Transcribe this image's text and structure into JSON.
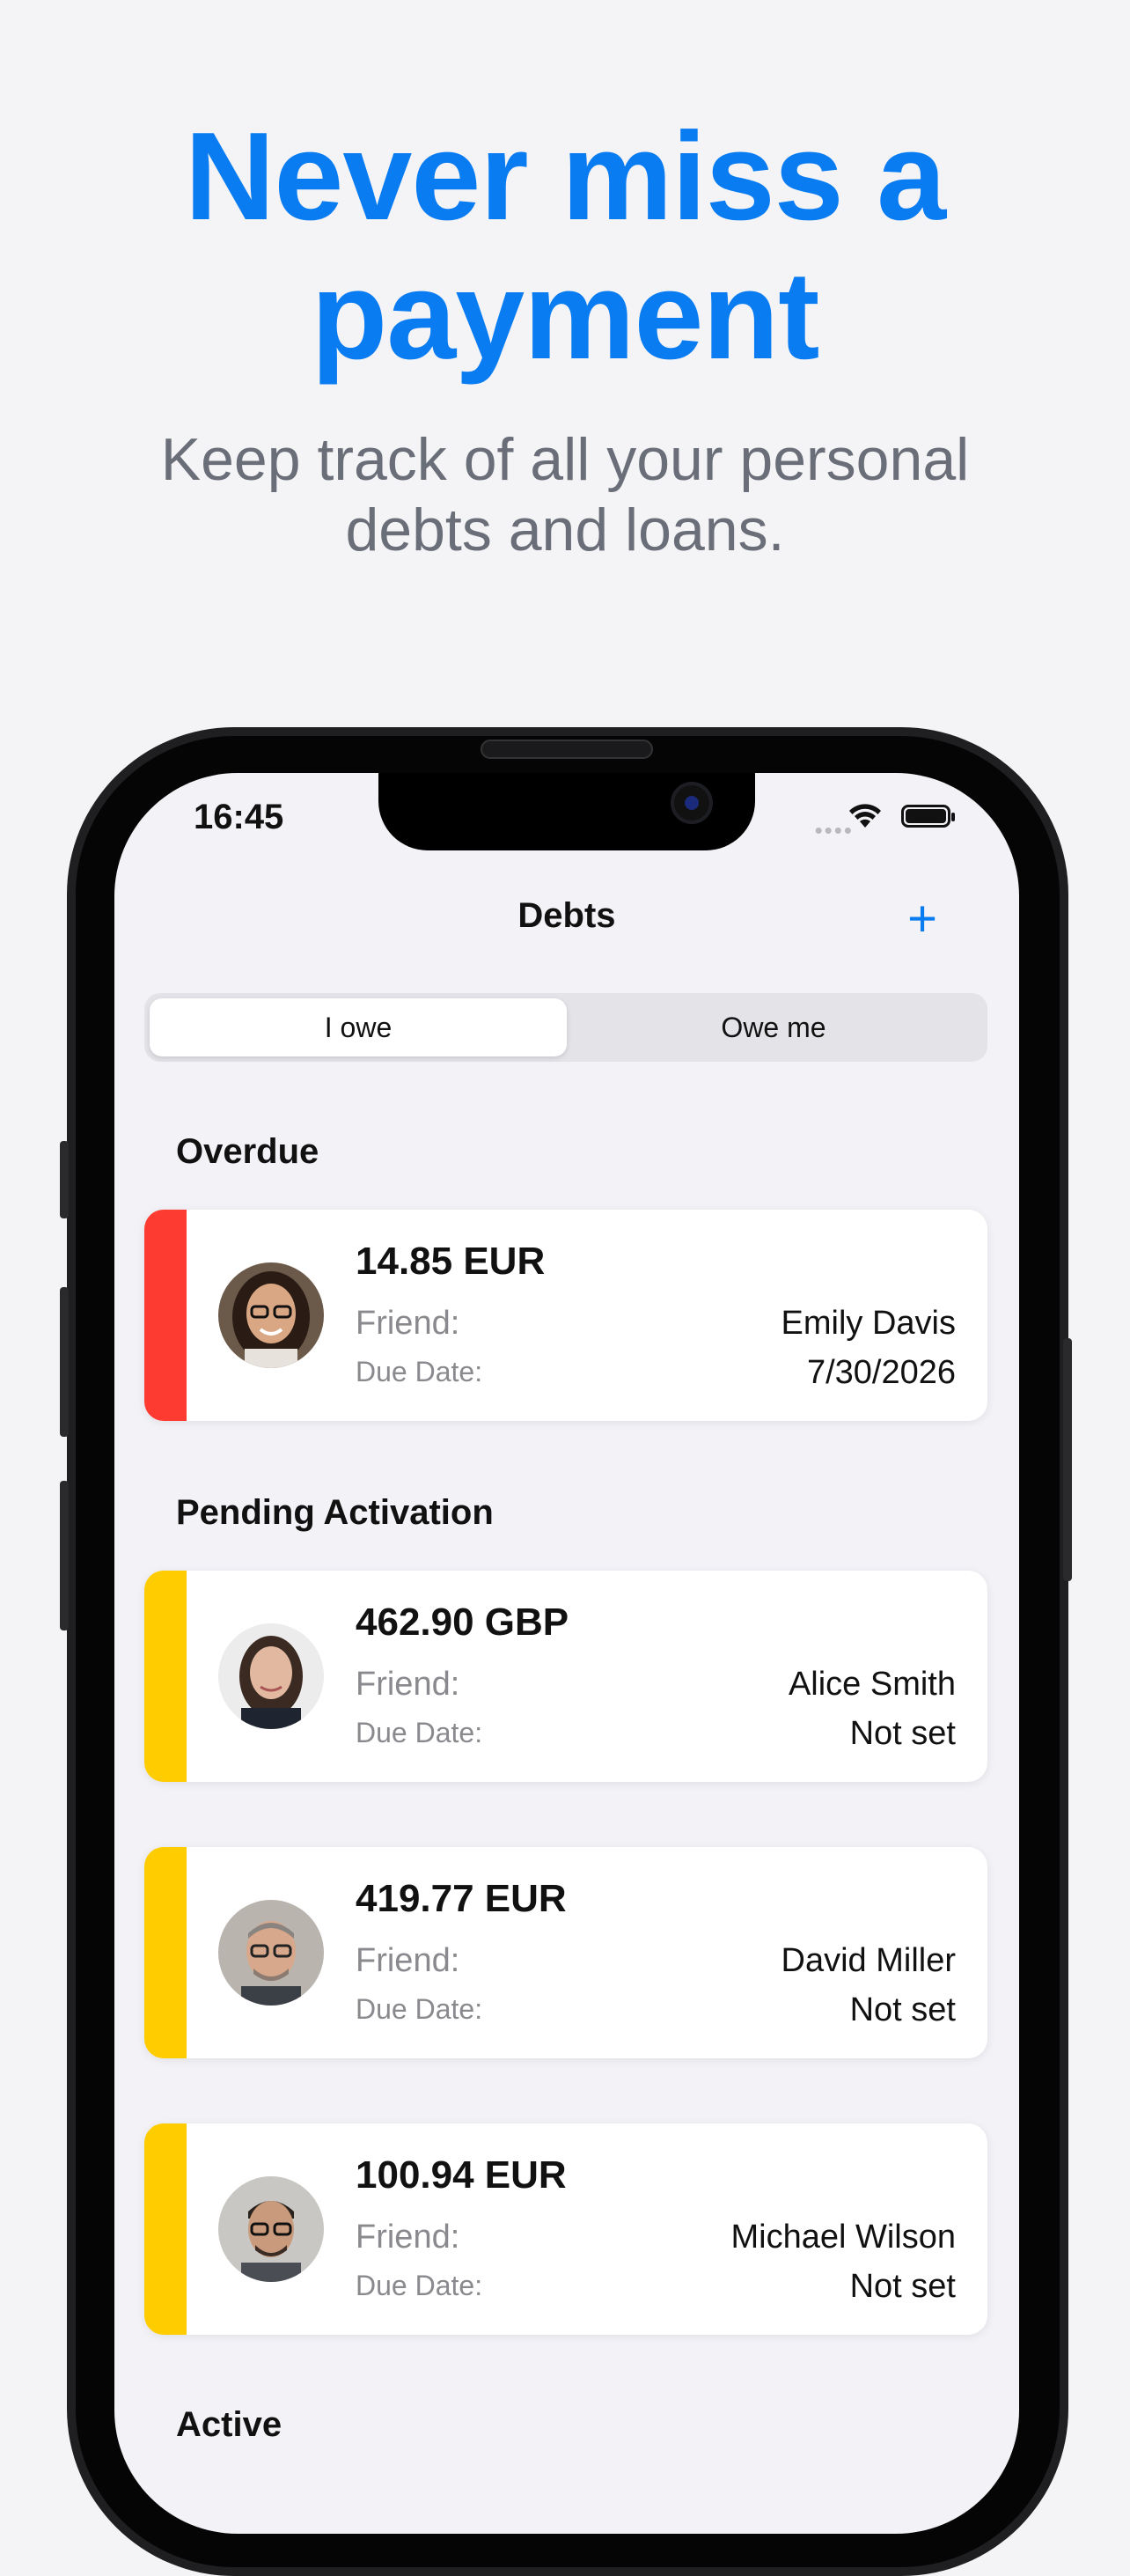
{
  "headline": {
    "line1": "Never miss a",
    "line2": "payment"
  },
  "subtitle": {
    "line1": "Keep track of all your personal",
    "line2": "debts and loans."
  },
  "status_bar": {
    "time": "16:45",
    "icons": [
      "wifi-icon",
      "battery-icon"
    ]
  },
  "nav": {
    "title": "Debts",
    "add_label": "+"
  },
  "segments": {
    "selected": "I owe",
    "items": [
      "I owe",
      "Owe me"
    ]
  },
  "sections": {
    "overdue": "Overdue",
    "pending": "Pending Activation",
    "active": "Active"
  },
  "labels": {
    "friend": "Friend:",
    "due_date": "Due Date:"
  },
  "colors": {
    "accent": "#0a7cf2",
    "overdue": "#fe3b30",
    "pending": "#ffcc00"
  },
  "debts": [
    {
      "amount": "14.85 EUR",
      "friend": "Emily Davis",
      "due_date": "7/30/2026",
      "status": "overdue"
    },
    {
      "amount": "462.90 GBP",
      "friend": "Alice Smith",
      "due_date": "Not set",
      "status": "pending"
    },
    {
      "amount": "419.77 EUR",
      "friend": "David Miller",
      "due_date": "Not set",
      "status": "pending"
    },
    {
      "amount": "100.94 EUR",
      "friend": "Michael Wilson",
      "due_date": "Not set",
      "status": "pending"
    }
  ]
}
